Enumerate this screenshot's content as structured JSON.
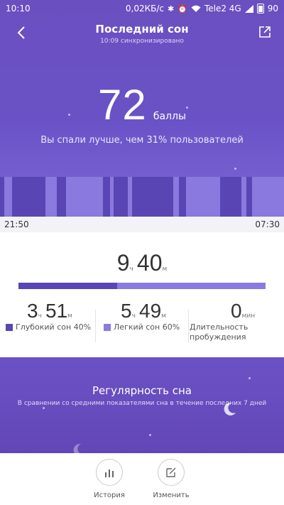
{
  "status_bar": {
    "time": "10:10",
    "speed": "0,02КБ/с",
    "carrier": "Tele2 4G",
    "battery": "90"
  },
  "header": {
    "title": "Последний сон",
    "synced": "10:09 синхронизировано"
  },
  "score": {
    "value": "72",
    "unit": "баллы",
    "comparison": "Вы спали лучше, чем 31% пользователей"
  },
  "timeline": {
    "start": "21:50",
    "end": "07:30",
    "colors": {
      "deep": "#5a45b4",
      "light": "#8a79de"
    }
  },
  "total": {
    "hours": "9",
    "hours_unit": "ч",
    "minutes": "40",
    "minutes_unit": "м",
    "deep_fraction": 0.4
  },
  "stats": {
    "deep": {
      "hours": "3",
      "hours_unit": "ч",
      "minutes": "51",
      "minutes_unit": "м",
      "label": "Глубокий сон 40%",
      "color": "#5a45b4"
    },
    "light": {
      "hours": "5",
      "hours_unit": "ч",
      "minutes": "49",
      "minutes_unit": "м",
      "label": "Легкий сон 60%",
      "color": "#8a7be0"
    },
    "awake": {
      "value": "0",
      "unit": "мин",
      "label_line1": "Длительность",
      "label_line2": "пробуждения"
    }
  },
  "regularity": {
    "title": "Регулярность сна",
    "subtitle": "В сравнении со средними показателями сна в течение последних 7 дней"
  },
  "bottom_bar": {
    "history_label": "История",
    "edit_label": "Изменить",
    "icons": {
      "history": "bar-chart-icon",
      "edit": "edit-icon"
    }
  }
}
